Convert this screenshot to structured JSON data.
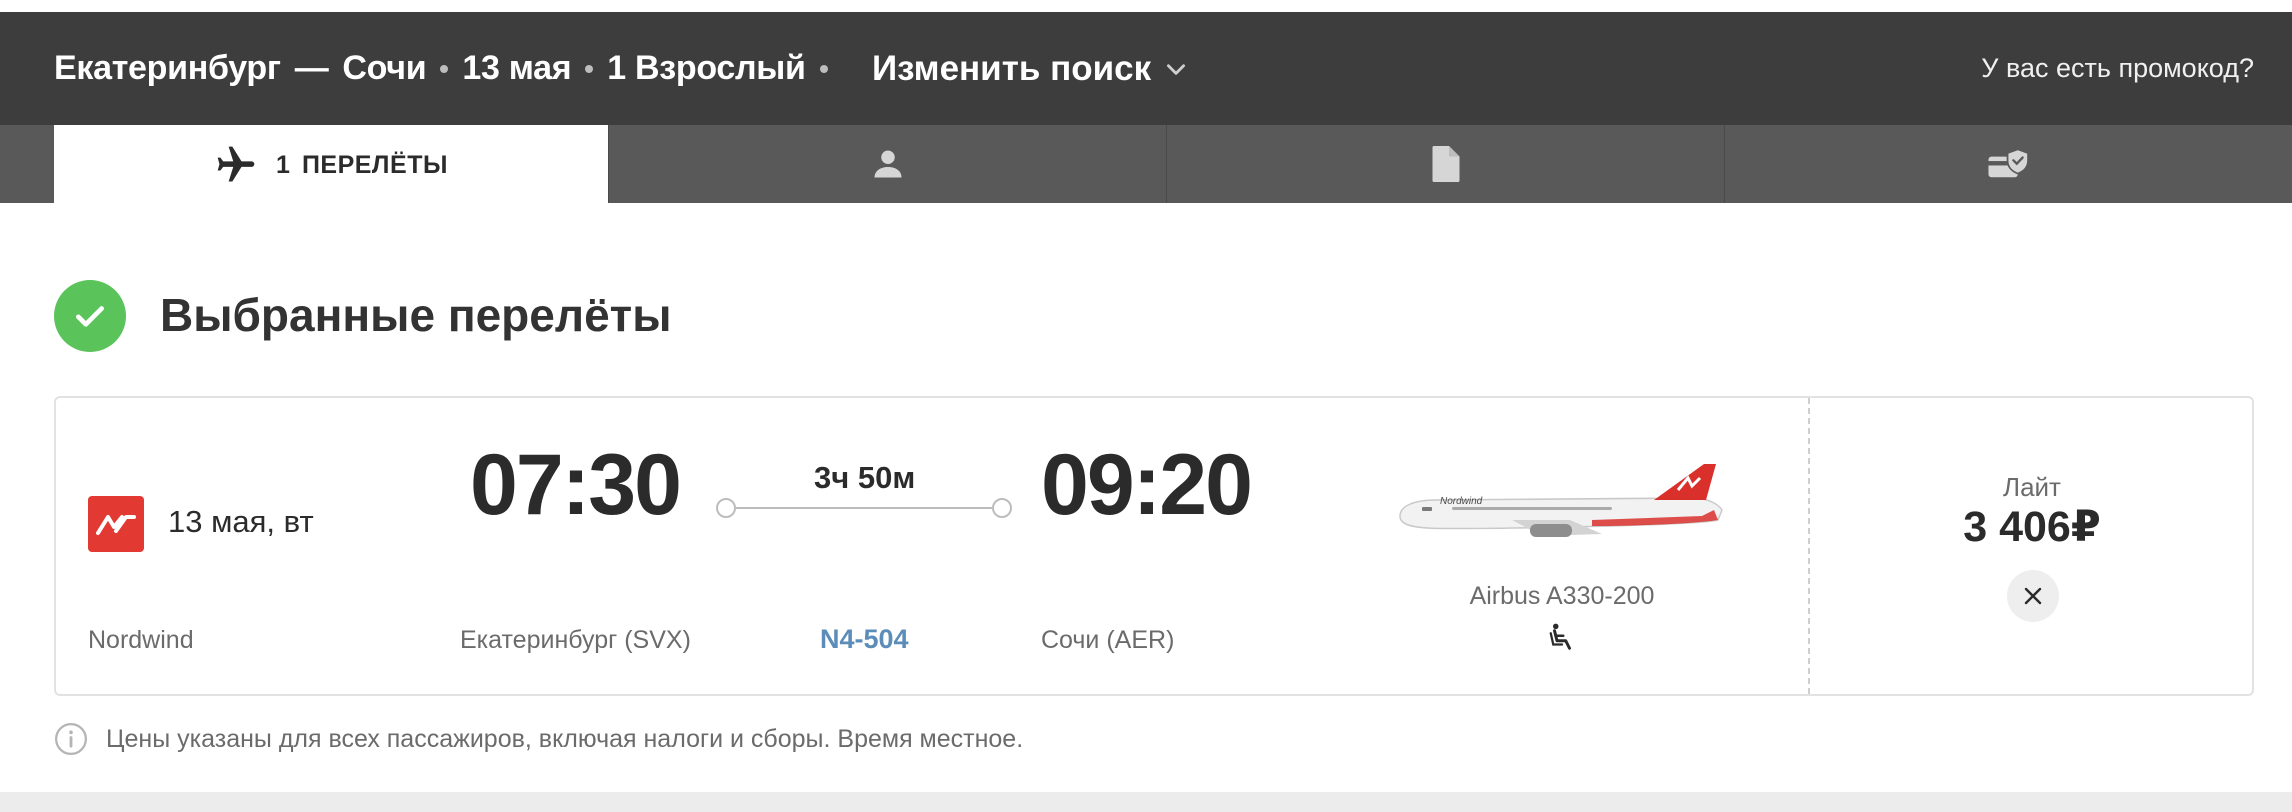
{
  "header": {
    "origin": "Екатеринбург",
    "route_dash": "—",
    "destination": "Сочи",
    "date": "13 мая",
    "passengers": "1 Взрослый",
    "change_search": "Изменить поиск",
    "promo": "У вас есть промокод?"
  },
  "tabs": [
    {
      "count": "1",
      "label": "ПЕРЕЛЁТЫ",
      "icon": "plane-icon",
      "active": true
    },
    {
      "label": "",
      "icon": "person-icon",
      "active": false
    },
    {
      "label": "",
      "icon": "document-icon",
      "active": false
    },
    {
      "label": "",
      "icon": "payment-shield-icon",
      "active": false
    }
  ],
  "page_title": "Выбранные перелёты",
  "flight": {
    "airline_logo": "nordwind-logo",
    "date": "13 мая, вт",
    "airline": "Nordwind",
    "departure_time": "07:30",
    "arrival_time": "09:20",
    "duration": "3ч 50м",
    "departure_city": "Екатеринбург (SVX)",
    "arrival_city": "Сочи (AER)",
    "flight_number": "N4-504",
    "aircraft": "Airbus A330-200",
    "aircraft_brand": "Nordwind",
    "amenity_icon": "seat-recline-icon",
    "fare_name": "Лайт",
    "price": "3 406₽"
  },
  "note": "Цены указаны для всех пассажиров, включая налоги и сборы. Время местное.",
  "colors": {
    "header_bg": "#3d3d3d",
    "tabs_bg": "#595959",
    "check_green": "#5ac35a",
    "link_blue": "#5b8db8",
    "airline_red": "#e23a33"
  }
}
